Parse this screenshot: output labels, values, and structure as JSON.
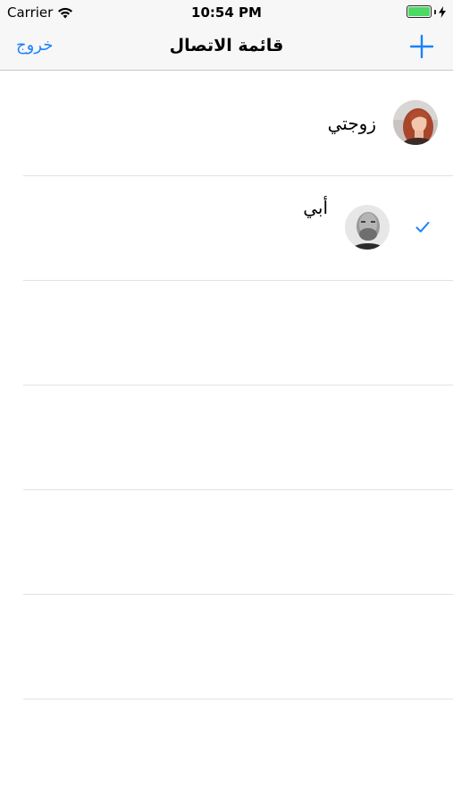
{
  "status_bar": {
    "carrier": "Carrier",
    "time": "10:54 PM"
  },
  "nav": {
    "title": "قائمة الاتصال",
    "left_button": "خروج",
    "right_icon": "plus-icon"
  },
  "contacts": [
    {
      "name": "زوجتي",
      "avatar": "woman-red-hair-photo",
      "selected": false
    },
    {
      "name": "أبي",
      "avatar": "older-man-bw-photo",
      "selected": true
    }
  ],
  "colors": {
    "accent": "#1a82fb",
    "battery": "#4cd964",
    "separator": "#e2e2e4"
  }
}
